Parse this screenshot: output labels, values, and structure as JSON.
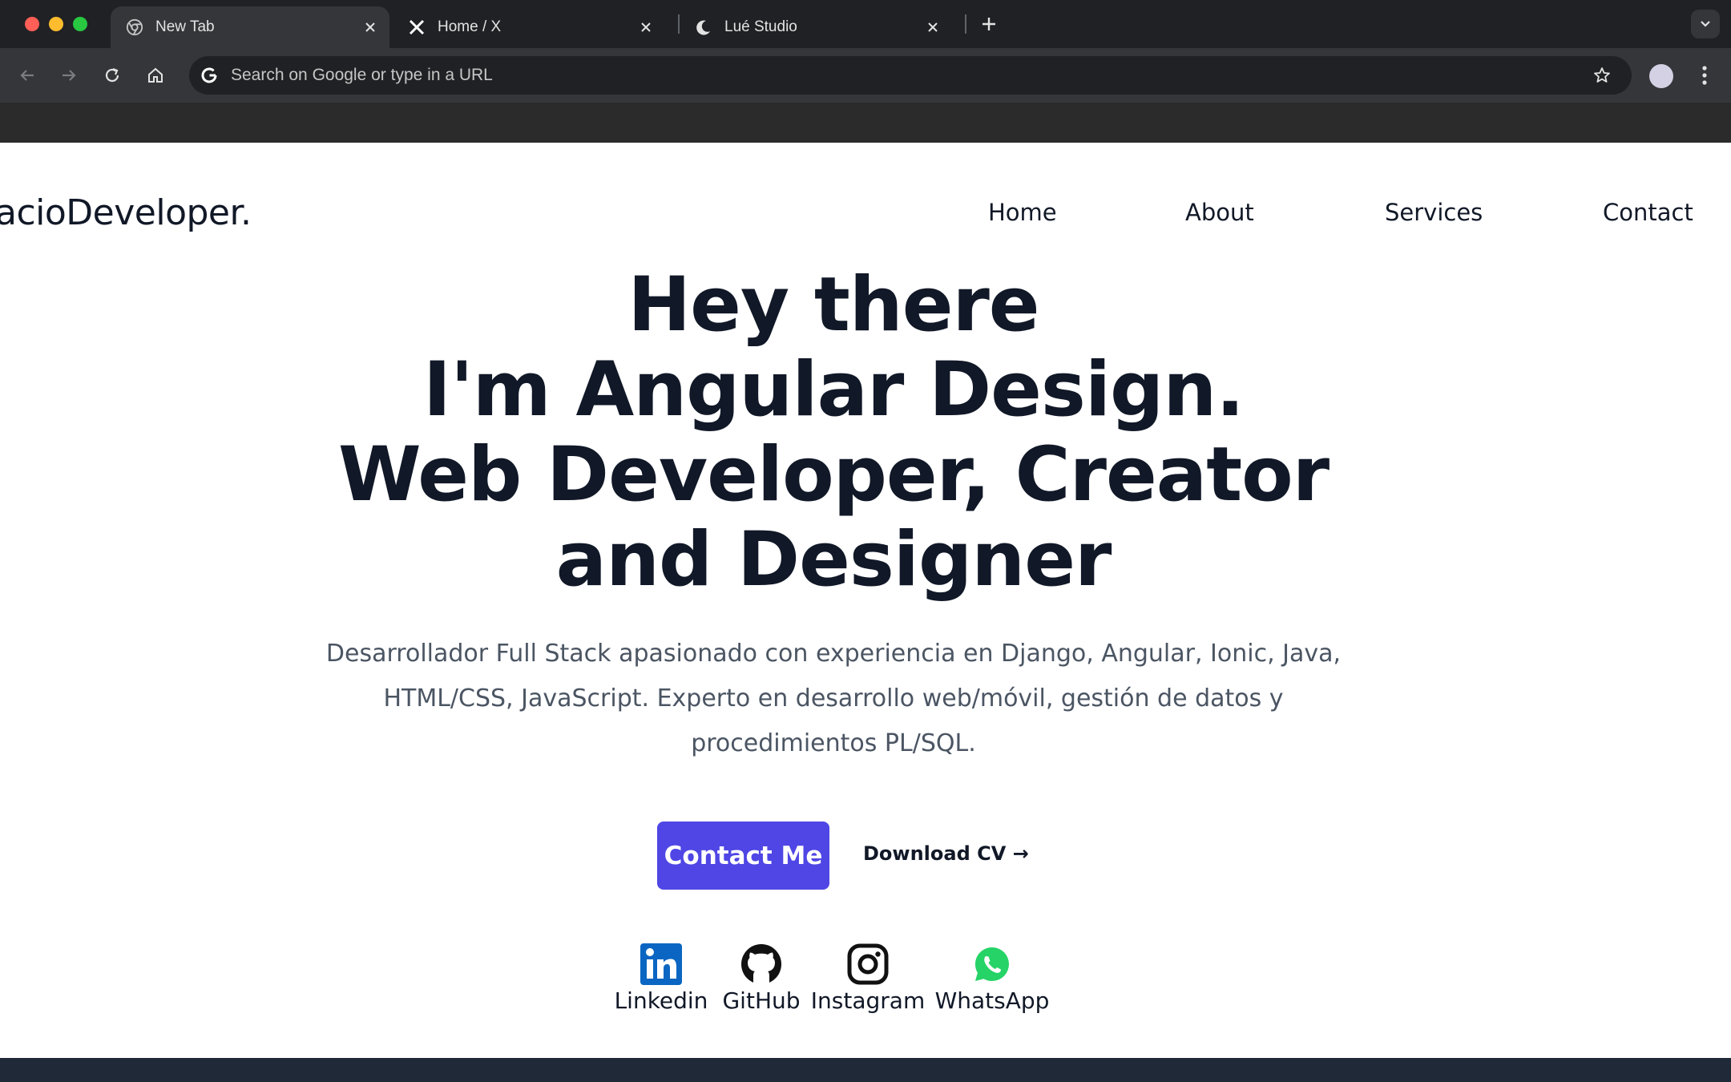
{
  "browser": {
    "tabs": [
      {
        "title": "New Tab",
        "icon": "chrome-icon",
        "active": true
      },
      {
        "title": "Home / X",
        "icon": "x-logo-icon",
        "active": false
      },
      {
        "title": "Lué Studio",
        "icon": "crescent-moon-icon",
        "active": false
      }
    ],
    "omnibox_placeholder": "Search on Google or type in a URL",
    "colors": {
      "tabstrip": "#202124",
      "toolbar": "#35363a",
      "omnibox": "#202124"
    }
  },
  "page": {
    "logo": "acioDeveloper.",
    "nav": [
      {
        "label": "Home"
      },
      {
        "label": "About"
      },
      {
        "label": "Services"
      },
      {
        "label": "Contact"
      }
    ],
    "hero_lines": [
      "Hey there",
      "I'm Angular Design.",
      "Web Developer, Creator",
      "and Designer"
    ],
    "description_lines": [
      "Desarrollador Full Stack apasionado con experiencia en Django, Angular, Ionic, Java,",
      "HTML/CSS, JavaScript. Experto en desarrollo web/móvil, gestión de datos y",
      "procedimientos PL/SQL."
    ],
    "cta_primary": "Contact Me",
    "cta_secondary": "Download CV →",
    "social": [
      {
        "label": "Linkedin",
        "icon": "linkedin-icon",
        "color": "#0a66c2"
      },
      {
        "label": "GitHub",
        "icon": "github-icon",
        "color": "#111111"
      },
      {
        "label": "Instagram",
        "icon": "instagram-icon",
        "color": "#111111"
      },
      {
        "label": "WhatsApp",
        "icon": "whatsapp-icon",
        "color": "#25d366"
      }
    ],
    "colors": {
      "accent": "#4f46e5",
      "text": "#111827",
      "muted": "#4b5563"
    }
  }
}
